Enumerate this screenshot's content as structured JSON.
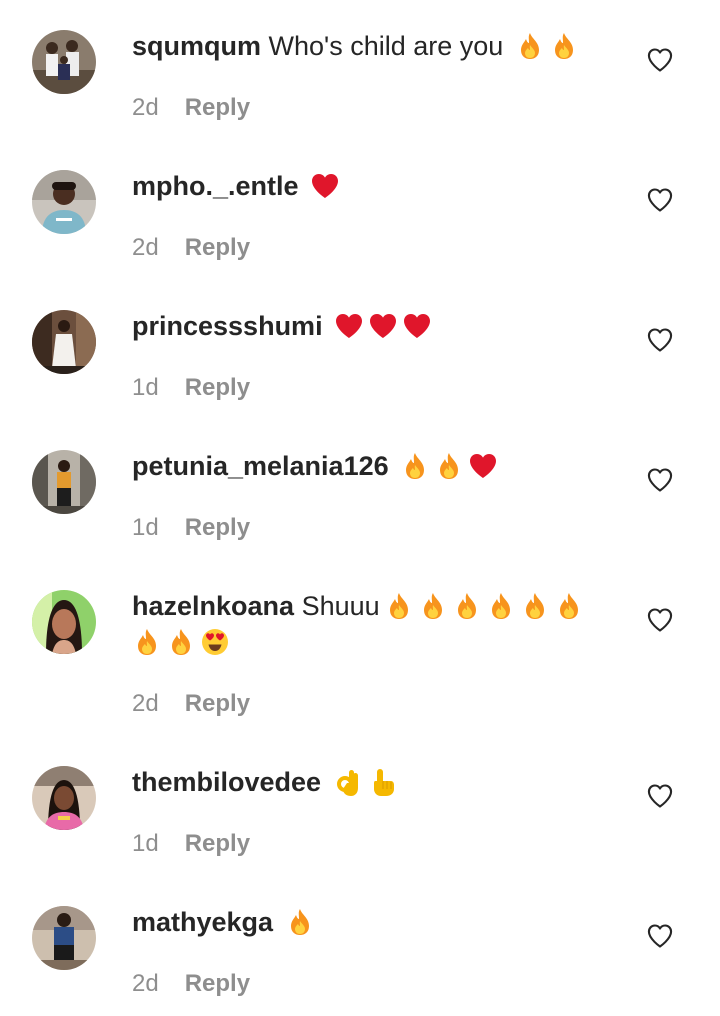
{
  "comments": [
    {
      "username": "squmqum",
      "text": "Who's child are you",
      "emojis": [
        "fire-emoji",
        "fire-emoji"
      ],
      "time": "2d",
      "reply_label": "Reply",
      "avatar": "avatar-photo-group"
    },
    {
      "username": "mpho._.entle",
      "text": "",
      "emojis": [
        "heart-emoji"
      ],
      "time": "2d",
      "reply_label": "Reply",
      "avatar": "avatar-photo-woman"
    },
    {
      "username": "princessshumi",
      "text": "",
      "emojis": [
        "heart-emoji",
        "heart-emoji",
        "heart-emoji"
      ],
      "time": "1d",
      "reply_label": "Reply",
      "avatar": "avatar-photo-white-dress"
    },
    {
      "username": "petunia_melania126",
      "text": "",
      "emojis": [
        "fire-emoji",
        "fire-emoji",
        "heart-emoji"
      ],
      "time": "1d",
      "reply_label": "Reply",
      "avatar": "avatar-photo-street"
    },
    {
      "username": "hazelnkoana",
      "text": "Shuuu",
      "emojis": [
        "fire-emoji",
        "fire-emoji",
        "fire-emoji",
        "fire-emoji",
        "fire-emoji",
        "fire-emoji",
        "fire-emoji",
        "fire-emoji",
        "heart-eyes-emoji"
      ],
      "time": "2d",
      "reply_label": "Reply",
      "avatar": "avatar-photo-portrait"
    },
    {
      "username": "thembilovedee",
      "text": "",
      "emojis": [
        "ok-hand-emoji",
        "pointing-up-emoji"
      ],
      "time": "1d",
      "reply_label": "Reply",
      "avatar": "avatar-photo-pink"
    },
    {
      "username": "mathyekga",
      "text": "",
      "emojis": [
        "fire-emoji"
      ],
      "time": "2d",
      "reply_label": "Reply",
      "avatar": "avatar-photo-standing"
    }
  ],
  "icons": {
    "like": "heart-outline-icon"
  },
  "colors": {
    "text": "#262626",
    "meta": "#8e8e8e",
    "heart": "#e0162b",
    "fire_outer": "#f7941d",
    "fire_inner": "#ffd23f"
  }
}
